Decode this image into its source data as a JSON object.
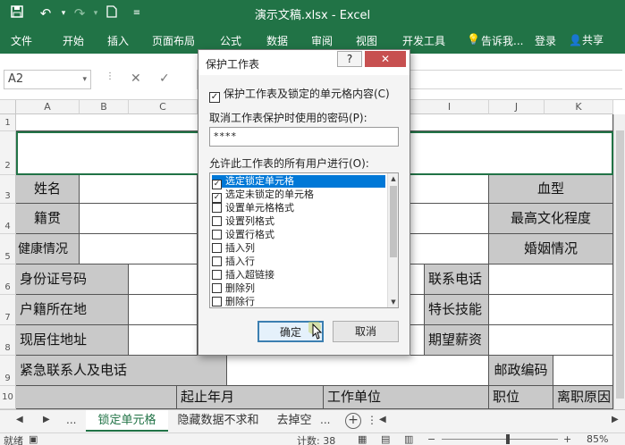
{
  "app": {
    "title": "演示文稿.xlsx - Excel",
    "qa_icons": [
      "save-icon",
      "undo-icon",
      "redo-icon",
      "new-file-icon",
      "customize-icon"
    ]
  },
  "ribbon": {
    "tabs": [
      "文件",
      "开始",
      "插入",
      "页面布局",
      "公式",
      "数据",
      "审阅",
      "视图",
      "开发工具"
    ],
    "tell_me": "告诉我...",
    "login": "登录",
    "share": "共享"
  },
  "formula_bar": {
    "name_box": "A2",
    "content": ""
  },
  "columns": [
    "A",
    "B",
    "C",
    "I",
    "J",
    "K"
  ],
  "rows": [
    "1",
    "2",
    "3",
    "4",
    "5",
    "6",
    "7",
    "8",
    "9",
    "10"
  ],
  "sheet": {
    "name": "姓名",
    "jiguan": "籍贯",
    "health": "健康情况",
    "id": "身份证号码",
    "huji": "户籍所在地",
    "address": "现居住地址",
    "emergency": "紧急联系人及电话",
    "blood": "血型",
    "edu": "最高文化程度",
    "marriage": "婚姻情况",
    "phone": "联系电话",
    "skill": "特长技能",
    "salary": "期望薪资",
    "postcode": "邮政编码",
    "period": "起止年月",
    "company": "工作单位",
    "position": "职位",
    "leave": "离职原因"
  },
  "sheet_tabs": {
    "ellipsis": "...",
    "tabs": [
      "锁定单元格",
      "隐藏数据不求和",
      "去掉空"
    ]
  },
  "status": {
    "ready": "就绪",
    "count": "计数: 38",
    "zoom": "85%"
  },
  "dialog": {
    "title": "保护工作表",
    "help": "?",
    "close": "✕",
    "protect_label": "保护工作表及锁定的单元格内容(C)",
    "protect_checked": true,
    "password_label": "取消工作表保护时使用的密码(P):",
    "password_value": "****",
    "allow_label": "允许此工作表的所有用户进行(O):",
    "permissions": [
      {
        "label": "选定锁定单元格",
        "checked": true,
        "selected": true
      },
      {
        "label": "选定未锁定的单元格",
        "checked": true,
        "selected": false
      },
      {
        "label": "设置单元格格式",
        "checked": false,
        "selected": false
      },
      {
        "label": "设置列格式",
        "checked": false,
        "selected": false
      },
      {
        "label": "设置行格式",
        "checked": false,
        "selected": false
      },
      {
        "label": "插入列",
        "checked": false,
        "selected": false
      },
      {
        "label": "插入行",
        "checked": false,
        "selected": false
      },
      {
        "label": "插入超链接",
        "checked": false,
        "selected": false
      },
      {
        "label": "删除列",
        "checked": false,
        "selected": false
      },
      {
        "label": "删除行",
        "checked": false,
        "selected": false
      }
    ],
    "ok": "确定",
    "cancel": "取消"
  },
  "colors": {
    "brand": "#217346",
    "header_cell": "#c9c9c9",
    "selection": "#0078d7"
  }
}
